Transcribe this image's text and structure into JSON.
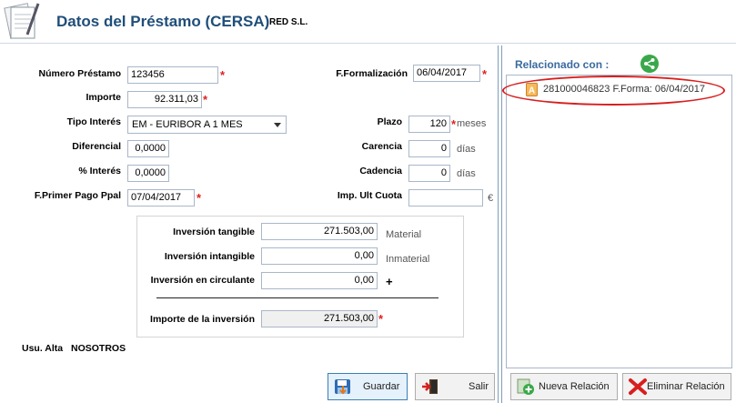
{
  "header": {
    "title": "Datos del Préstamo (CERSA)",
    "company": "RED S.L."
  },
  "form": {
    "numero_prestamo": {
      "label": "Número Préstamo",
      "value": "123456"
    },
    "importe": {
      "label": "Importe",
      "value": "92.311,03"
    },
    "tipo_interes": {
      "label": "Tipo Interés",
      "value": "EM - EURIBOR A 1 MES"
    },
    "diferencial": {
      "label": "Diferencial",
      "value": "0,0000"
    },
    "pct_interes": {
      "label": "% Interés",
      "value": "0,0000"
    },
    "f_primer_pago": {
      "label": "F.Primer Pago Ppal",
      "value": "07/04/2017"
    },
    "f_formalizacion": {
      "label": "F.Formalización",
      "value": "06/04/2017"
    },
    "plazo": {
      "label": "Plazo",
      "value": "120",
      "unit": "meses"
    },
    "carencia": {
      "label": "Carencia",
      "value": "0",
      "unit": "días"
    },
    "cadencia": {
      "label": "Cadencia",
      "value": "0",
      "unit": "días"
    },
    "imp_ult_cuota": {
      "label": "Imp. Ult Cuota",
      "value": "",
      "unit": "€"
    },
    "required_mark": "*"
  },
  "investment": {
    "tangible": {
      "label": "Inversión tangible",
      "value": "271.503,00",
      "note": "Material"
    },
    "intangible": {
      "label": "Inversión intangible",
      "value": "0,00",
      "note": "Inmaterial"
    },
    "circulante": {
      "label": "Inversión en circulante",
      "value": "0,00",
      "note": "+"
    },
    "total": {
      "label": "Importe de la inversión",
      "value": "271.503,00"
    }
  },
  "usu_alta": {
    "label": "Usu. Alta",
    "value": "NOSOTROS"
  },
  "buttons": {
    "guardar": "Guardar",
    "salir": "Salir",
    "nueva_relacion": "Nueva Relación",
    "eliminar_relacion": "Eliminar Relación"
  },
  "related": {
    "title": "Relacionado con :",
    "items": [
      {
        "text": "281000046823 F.Forma: 06/04/2017",
        "icon": "document-a-icon"
      }
    ]
  },
  "colors": {
    "title": "#1f4e79",
    "accent": "#3a6aa0",
    "required": "#e02020",
    "highlight": "#d81e1e"
  }
}
